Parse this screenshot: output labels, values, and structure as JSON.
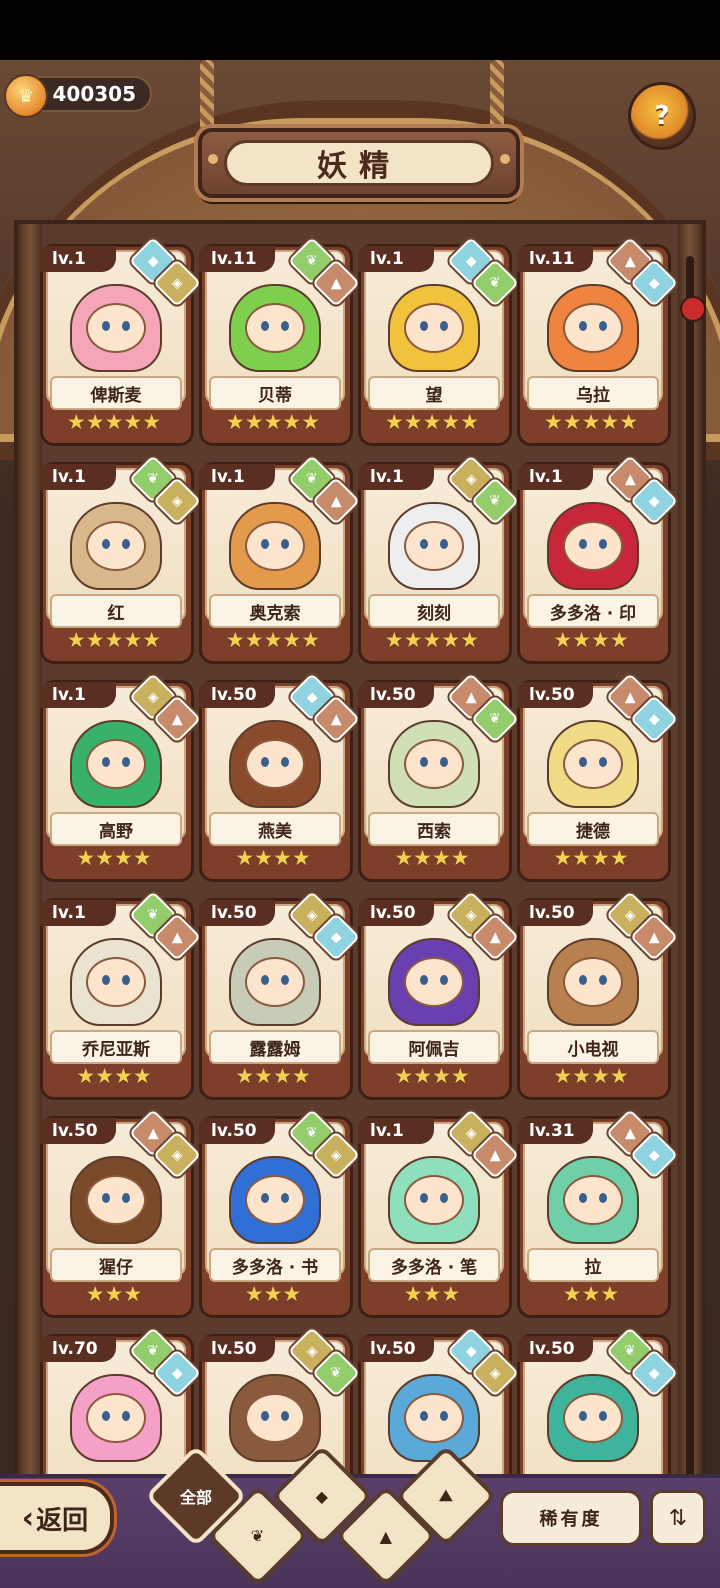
{
  "header": {
    "currency_value": "400305",
    "currency_icon": "crown-coin-icon",
    "help_icon": "question-bulb-icon",
    "title": "妖精"
  },
  "colors": {
    "card_back": "#7d3e2a",
    "star": "#f3cf52",
    "water": "#8fd3e0",
    "plant": "#93cc6a",
    "mountain": "#c78a6b",
    "earth": "#c9b05e"
  },
  "fairies": [
    {
      "level": "lv.1",
      "name": "俾斯麦",
      "stars": "★★★★★",
      "elements": [
        "water",
        "earth"
      ],
      "hair": "#f4a6b8"
    },
    {
      "level": "lv.11",
      "name": "贝蒂",
      "stars": "★★★★★",
      "elements": [
        "plant",
        "mountain"
      ],
      "hair": "#7fcf4f"
    },
    {
      "level": "lv.1",
      "name": "望",
      "stars": "★★★★★",
      "elements": [
        "water",
        "plant"
      ],
      "hair": "#f1c23c"
    },
    {
      "level": "lv.11",
      "name": "乌拉",
      "stars": "★★★★★",
      "elements": [
        "mountain",
        "water"
      ],
      "hair": "#ee8440"
    },
    {
      "level": "lv.1",
      "name": "红",
      "stars": "★★★★★",
      "elements": [
        "plant",
        "earth"
      ],
      "hair": "#d8b78a"
    },
    {
      "level": "lv.1",
      "name": "奥克索",
      "stars": "★★★★★",
      "elements": [
        "plant",
        "mountain"
      ],
      "hair": "#e49a4d"
    },
    {
      "level": "lv.1",
      "name": "刻刻",
      "stars": "★★★★★",
      "elements": [
        "earth",
        "plant"
      ],
      "hair": "#eeeeee"
    },
    {
      "level": "lv.1",
      "name": "多多洛 · 印",
      "stars": "★★★★",
      "elements": [
        "mountain",
        "water"
      ],
      "hair": "#c8263a"
    },
    {
      "level": "lv.1",
      "name": "高野",
      "stars": "★★★★",
      "elements": [
        "earth",
        "mountain"
      ],
      "hair": "#38b26a"
    },
    {
      "level": "lv.50",
      "name": "燕美",
      "stars": "★★★★",
      "elements": [
        "water",
        "mountain"
      ],
      "hair": "#8a4a2c"
    },
    {
      "level": "lv.50",
      "name": "西索",
      "stars": "★★★★",
      "elements": [
        "mountain",
        "plant"
      ],
      "hair": "#cfe0b6"
    },
    {
      "level": "lv.50",
      "name": "捷德",
      "stars": "★★★★",
      "elements": [
        "mountain",
        "water"
      ],
      "hair": "#f0dc87"
    },
    {
      "level": "lv.1",
      "name": "乔尼亚斯",
      "stars": "★★★★",
      "elements": [
        "plant",
        "mountain"
      ],
      "hair": "#e9e3cf"
    },
    {
      "level": "lv.50",
      "name": "露露姆",
      "stars": "★★★★",
      "elements": [
        "earth",
        "water"
      ],
      "hair": "#c7ccb6"
    },
    {
      "level": "lv.50",
      "name": "阿佩吉",
      "stars": "★★★★",
      "elements": [
        "earth",
        "mountain"
      ],
      "hair": "#6a3fb0"
    },
    {
      "level": "lv.50",
      "name": "小电视",
      "stars": "★★★★",
      "elements": [
        "earth",
        "mountain"
      ],
      "hair": "#b8804e"
    },
    {
      "level": "lv.50",
      "name": "猩仔",
      "stars": "★★★",
      "elements": [
        "mountain",
        "earth"
      ],
      "hair": "#7a4a2a"
    },
    {
      "level": "lv.50",
      "name": "多多洛 · 书",
      "stars": "★★★",
      "elements": [
        "plant",
        "earth"
      ],
      "hair": "#2f6fd6"
    },
    {
      "level": "lv.1",
      "name": "多多洛 · 笔",
      "stars": "★★★",
      "elements": [
        "earth",
        "mountain"
      ],
      "hair": "#8ee0bd"
    },
    {
      "level": "lv.31",
      "name": "拉",
      "stars": "★★★",
      "elements": [
        "mountain",
        "water"
      ],
      "hair": "#6ecfa8"
    },
    {
      "level": "lv.70",
      "name": "",
      "stars": "",
      "elements": [
        "plant",
        "water"
      ],
      "hair": "#f5a0c6"
    },
    {
      "level": "lv.50",
      "name": "",
      "stars": "",
      "elements": [
        "earth",
        "plant"
      ],
      "hair": "#8a5a3c"
    },
    {
      "level": "lv.50",
      "name": "",
      "stars": "",
      "elements": [
        "water",
        "earth"
      ],
      "hair": "#5aa9d8"
    },
    {
      "level": "lv.50",
      "name": "",
      "stars": "",
      "elements": [
        "plant",
        "water"
      ],
      "hair": "#3fb49c"
    }
  ],
  "bottom_bar": {
    "back_label": "返回",
    "filter_all_label": "全部",
    "filter_icons": [
      "water-drop-icon",
      "sprout-icon",
      "mountain-icon",
      "peak-icon"
    ],
    "sort_label": "稀有度",
    "order_icon": "sort-order-icon"
  }
}
